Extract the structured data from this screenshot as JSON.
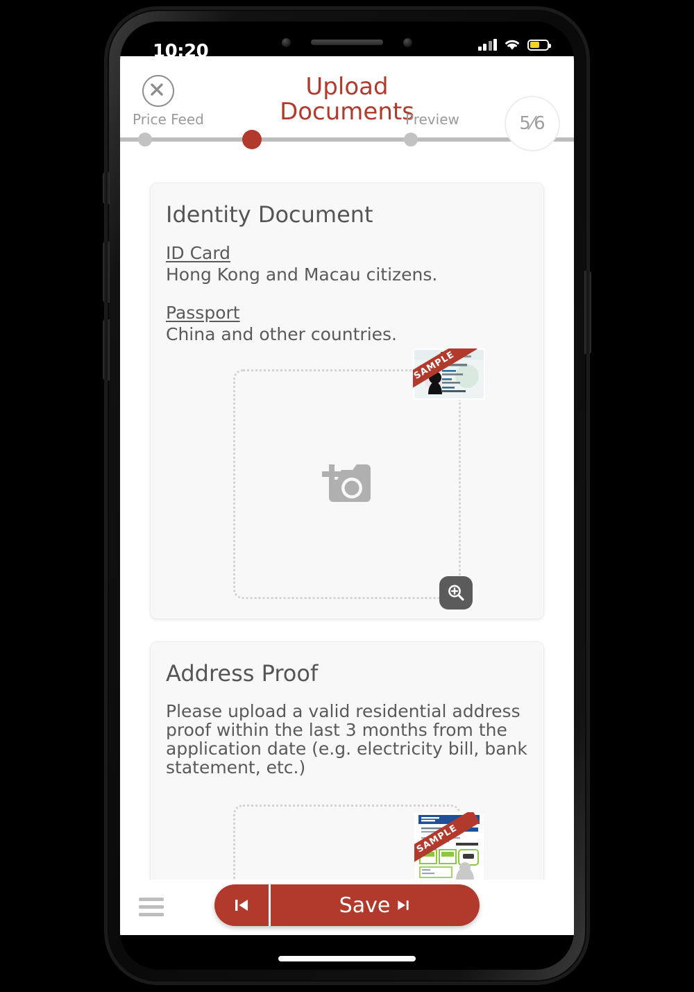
{
  "status_bar": {
    "time": "10:20",
    "signal_icon": "cellular-signal-icon",
    "wifi_icon": "wifi-icon",
    "battery_icon": "battery-icon",
    "battery_color": "#f5d12a"
  },
  "header": {
    "close_icon": "close-icon",
    "title": "Upload Documents",
    "prev_step_label": "Price Feed",
    "next_step_label": "Preview",
    "page_counter": "5⁄6",
    "page_current": "5",
    "page_total": "6",
    "accent_color": "#b23a2c",
    "track_color": "#bdbdbd",
    "steps": [
      {
        "label": "Price Feed",
        "active": false
      },
      {
        "label": "Upload Documents",
        "active": true
      },
      {
        "label": "Preview",
        "active": false
      }
    ]
  },
  "cards": [
    {
      "title": "Identity Document",
      "items": [
        {
          "type": "ID Card",
          "desc": "Hong Kong and Macau citizens."
        },
        {
          "type": "Passport",
          "desc": "China and other countries."
        }
      ],
      "dropzone": {
        "upload_icon": "add-photo-camera-icon",
        "sample_label": "SAMPLE",
        "sample_alt": "sample-id-card-thumbnail",
        "zoom_icon": "magnifier-plus-icon"
      }
    },
    {
      "title": "Address Proof",
      "description": "Please upload a valid residential address proof within the last 3 months from the application date (e.g. electricity bill, bank statement, etc.)",
      "dropzone": {
        "sample_label": "SAMPLE",
        "sample_alt": "sample-address-proof-thumbnail"
      }
    }
  ],
  "bottom_bar": {
    "menu_icon": "hamburger-menu-icon",
    "prev_icon": "skip-previous-icon",
    "save_label": "Save",
    "next_icon": "skip-next-icon",
    "button_color": "#b23a2c"
  }
}
